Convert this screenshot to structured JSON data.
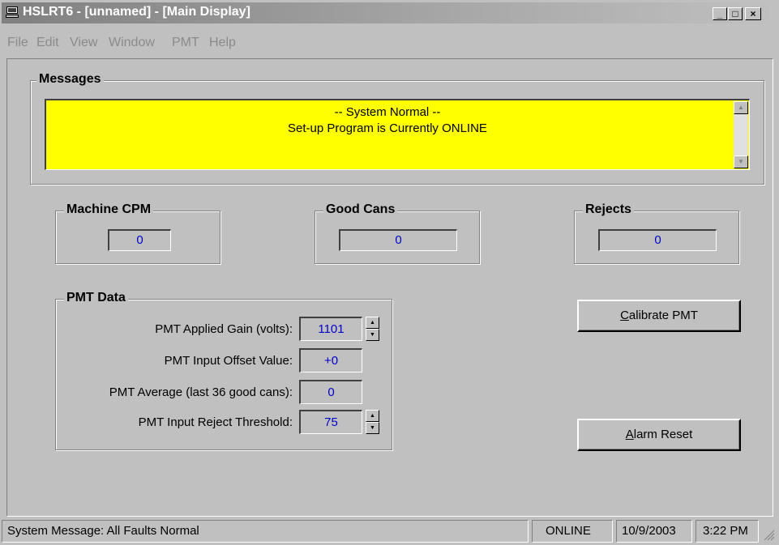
{
  "window": {
    "title": "HSLRT6 - [unnamed] - [Main Display]",
    "minimize_label": "_",
    "restore_label": "□",
    "close_label": "×"
  },
  "menu": [
    "File",
    "Edit",
    "View",
    "Window",
    "PMT",
    "Help"
  ],
  "messages": {
    "legend": "Messages",
    "line1": "-- System Normal --",
    "line2": "Set-up Program is Currently ONLINE",
    "background_color": "#ffff00"
  },
  "counters": {
    "machine_cpm": {
      "label": "Machine CPM",
      "value": "0"
    },
    "good_cans": {
      "label": "Good Cans",
      "value": "0"
    },
    "rejects": {
      "label": "Rejects",
      "value": "0"
    }
  },
  "pmt": {
    "legend": "PMT Data",
    "applied_gain": {
      "label": "PMT Applied Gain (volts):",
      "value": "1101"
    },
    "input_offset": {
      "label": "PMT Input Offset Value:",
      "value": "+0"
    },
    "average": {
      "label": "PMT Average (last 36 good cans):",
      "value": "0"
    },
    "reject_threshold": {
      "label": "PMT Input Reject Threshold:",
      "value": "75"
    }
  },
  "buttons": {
    "calibrate_key": "C",
    "calibrate_rest": "alibrate PMT",
    "alarm_key": "A",
    "alarm_rest": "larm Reset"
  },
  "status": {
    "message": "System Message:  All Faults Normal",
    "mode": "ONLINE",
    "date": "10/9/2003",
    "time": "3:22 PM"
  },
  "colors": {
    "value_text": "#0000cc",
    "face": "#c0c0c0"
  }
}
